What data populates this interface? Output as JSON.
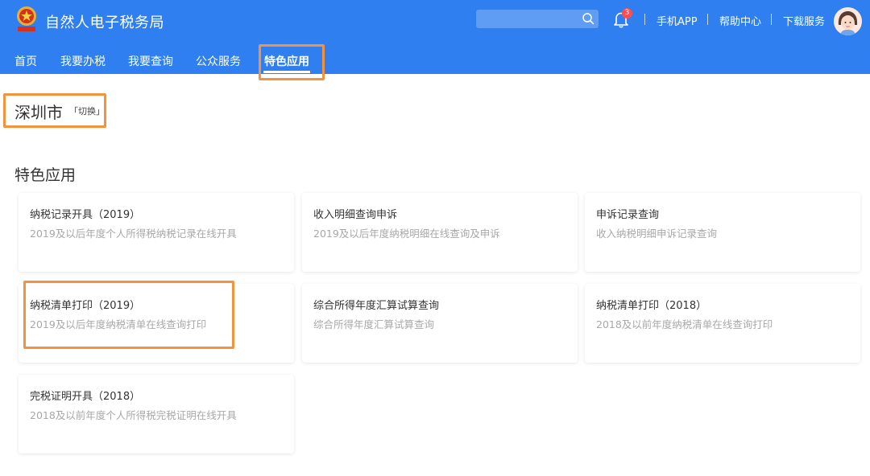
{
  "header": {
    "site_title": "自然人电子税务局",
    "search": {
      "placeholder": ""
    },
    "notifications_count": "3",
    "links": [
      "手机APP",
      "帮助中心",
      "下载服务"
    ],
    "brand_color": "#2f7ff0"
  },
  "nav": {
    "items": [
      "首页",
      "我要办税",
      "我要查询",
      "公众服务",
      "特色应用"
    ],
    "active": "特色应用"
  },
  "location": {
    "city": "深圳市",
    "switch_label": "「切换」"
  },
  "section": {
    "title": "特色应用"
  },
  "cards": [
    {
      "title": "纳税记录开具（2019）",
      "desc": "2019及以后年度个人所得税纳税记录在线开具"
    },
    {
      "title": "收入明细查询申诉",
      "desc": "2019及以后年度纳税明细在线查询及申诉"
    },
    {
      "title": "申诉记录查询",
      "desc": "收入纳税明细申诉记录查询"
    },
    {
      "title": "纳税清单打印（2019）",
      "desc": "2019及以后年度纳税清单在线查询打印"
    },
    {
      "title": "综合所得年度汇算试算查询",
      "desc": "综合所得年度汇算试算查询"
    },
    {
      "title": "纳税清单打印（2018）",
      "desc": "2018及以前年度纳税清单在线查询打印"
    },
    {
      "title": "完税证明开具（2018）",
      "desc": "2018及以前年度个人所得税完税证明在线开具"
    }
  ],
  "icons": {
    "logo": "tax-emblem-icon",
    "search": "search-icon",
    "bell": "bell-icon",
    "avatar": "user-avatar"
  },
  "highlight_color": "#f5923e"
}
